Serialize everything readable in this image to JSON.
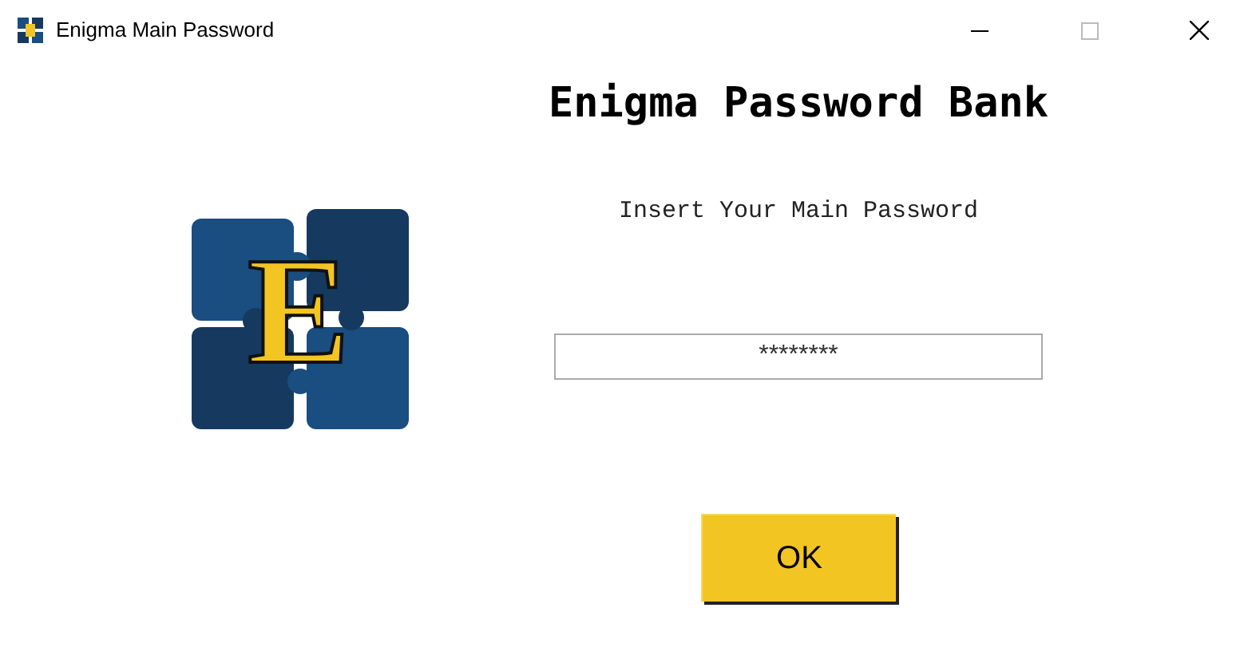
{
  "window": {
    "title": "Enigma Main Password"
  },
  "logo": {
    "letter": "E"
  },
  "heading": "Enigma Password Bank",
  "prompt": "Insert Your Main Password",
  "password_field": {
    "value": "********"
  },
  "ok_button": {
    "label": "OK"
  }
}
